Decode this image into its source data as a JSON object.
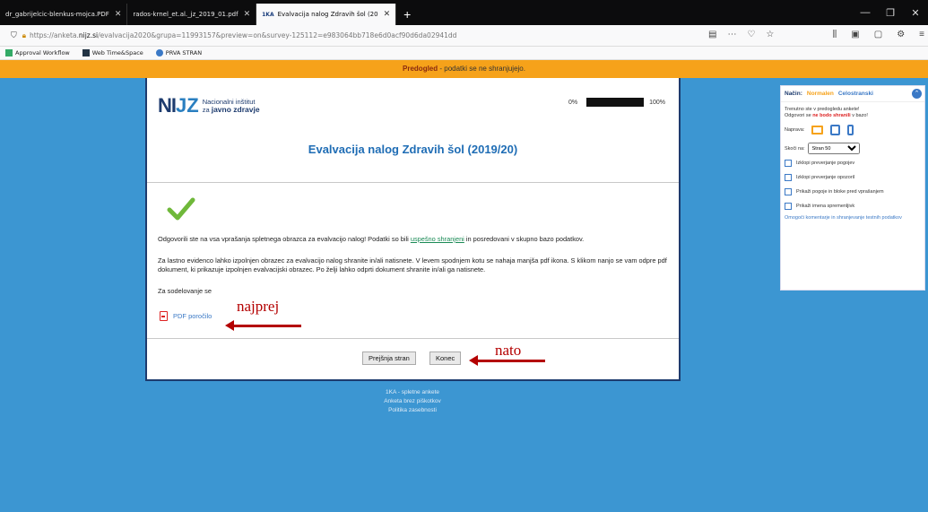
{
  "browser": {
    "tabs": [
      {
        "label": "dr_gabrijelcic-blenkus-mojca.PDF",
        "active": false
      },
      {
        "label": "rados-krnel_et.al._jz_2019_01.pdf",
        "active": false
      },
      {
        "label": "Evalvacija nalog Zdravih šol (20",
        "active": true
      }
    ],
    "new_tab": "+",
    "url_scheme": "https://anketa.",
    "url_host": "nijz.si",
    "url_path": "/evalvacija2020&grupa=11993157&preview=on&survey-125112=e983064bb718e6d0acf90d6da02941dd",
    "bookmarks": [
      "Approval Workflow",
      "Web Time&Space",
      "PRVA STRAN"
    ]
  },
  "preview_bar": {
    "bold": "Predogled",
    "text": " - podatki se ne shranjujejo."
  },
  "survey": {
    "logo_letters_a": "NI",
    "logo_letters_b": "JZ",
    "logo_line1": "Nacionalni inštitut",
    "logo_line2_a": "za ",
    "logo_line2_b": "javno zdravje",
    "progress_start": "0%",
    "progress_end": "100%",
    "progress_value": 1.0,
    "title": "Evalvacija nalog Zdravih šol (2019/20)",
    "text1_a": "Odgovorili ste na vsa vprašanja spletnega obrazca za evalvacijo nalog! Podatki so bili ",
    "text1_link": "uspešno shranjeni",
    "text1_b": " in posredovani v skupno bazo podatkov.",
    "text2": "Za lastno evidenco lahko izpolnjen obrazec za evalvacijo nalog shranite in/ali natisnete. V levem spodnjem kotu se nahaja manjša pdf ikona. S klikom nanjo se vam odpre pdf dokument, ki prikazuje izpolnjen evalvacijski obrazec. Po želji lahko odprti dokument shranite in/ali ga natisnete.",
    "text3": "Za sodelovanje se",
    "pdf_link": "PDF poročilo",
    "btn_prev": "Prejšnja stran",
    "btn_end": "Konec"
  },
  "annotations": {
    "first": "najprej",
    "second": "nato"
  },
  "footer": [
    "1KA - spletne ankete",
    "Anketa brez piškotkov",
    "Politika zasebnosti"
  ],
  "side_panel": {
    "mode_label": "Način:",
    "mode_normal": "Normalen",
    "mode_full": "Celostranski",
    "info_a": "Trenutno ste v predogledu ankete!",
    "info_b": "Odgovori se ",
    "info_warn": "ne bodo shranili",
    "info_c": " v bazo!",
    "devices_label": "Naprava:",
    "jump_label": "Skoči na:",
    "jump_value": "Stran 50",
    "options": [
      "Izklopi preverjanje pogojev",
      "Izklopi preverjanje opozoril",
      "Prikaži pogoje in bloke pred vprašanjem",
      "Prikaži imena spremenljivk"
    ],
    "comments_link": "Omogoči komentarje in shranjevanje testnih podatkov"
  },
  "colors": {
    "brand_orange": "#f6a21a",
    "page_blue": "#3c96d2",
    "title_blue": "#1f6db5",
    "annotation_red": "#b40000"
  }
}
